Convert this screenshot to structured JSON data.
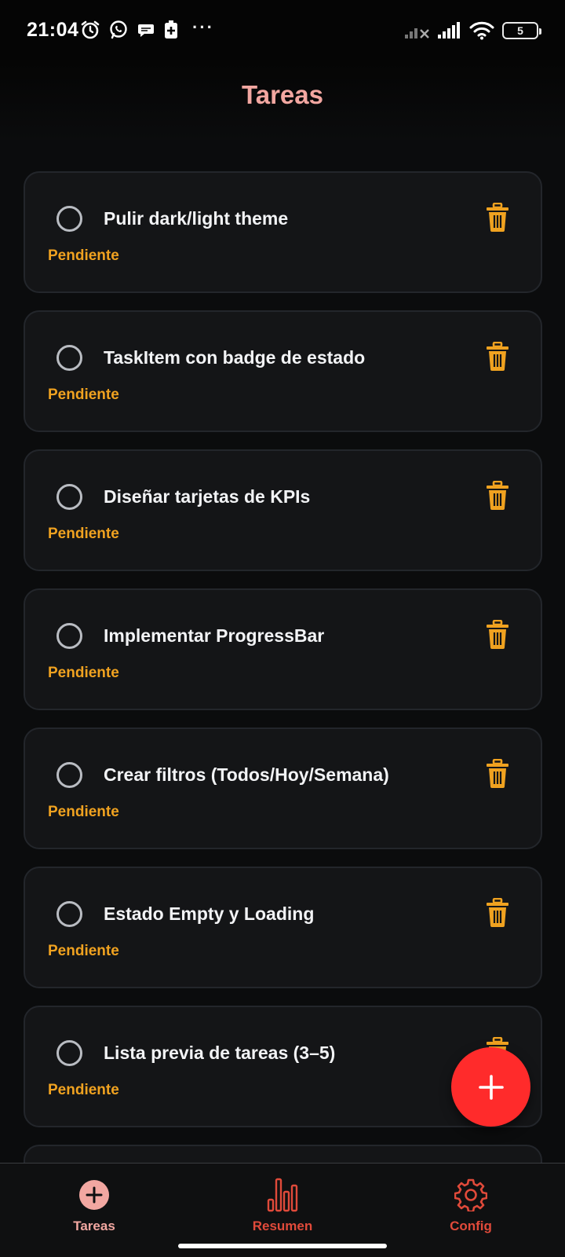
{
  "status_bar": {
    "time": "21:04",
    "battery_level": "5",
    "left_icons": [
      "alarm-icon",
      "whatsapp-icon",
      "chat-bubble-icon",
      "battery-saver-icon"
    ],
    "right_icons": [
      "signal-off-icon",
      "signal-icon",
      "wifi-icon",
      "battery-icon"
    ],
    "overflow": "···"
  },
  "header": {
    "title": "Tareas"
  },
  "tasks": [
    {
      "title": "Pulir dark/light theme",
      "status": "Pendiente",
      "completed": false
    },
    {
      "title": "TaskItem con badge de estado",
      "status": "Pendiente",
      "completed": false
    },
    {
      "title": "Diseñar tarjetas de KPIs",
      "status": "Pendiente",
      "completed": false
    },
    {
      "title": "Implementar ProgressBar",
      "status": "Pendiente",
      "completed": false
    },
    {
      "title": "Crear filtros (Todos/Hoy/Semana)",
      "status": "Pendiente",
      "completed": false
    },
    {
      "title": "Estado Empty y Loading",
      "status": "Pendiente",
      "completed": false
    },
    {
      "title": "Lista previa de tareas (3–5)",
      "status": "Pendiente",
      "completed": false
    }
  ],
  "fab": {
    "icon": "plus-icon"
  },
  "bottom_nav": {
    "items": [
      {
        "label": "Tareas",
        "icon": "add-circle-icon",
        "active": true
      },
      {
        "label": "Resumen",
        "icon": "bar-chart-icon",
        "active": false
      },
      {
        "label": "Config",
        "icon": "gear-icon",
        "active": false
      }
    ]
  },
  "colors": {
    "background": "#0b0c0d",
    "card": "#141517",
    "title_accent": "#f2a7a1",
    "status_pending": "#f0a220",
    "fab": "#ff2b2b",
    "nav_inactive": "#e04a3a"
  }
}
